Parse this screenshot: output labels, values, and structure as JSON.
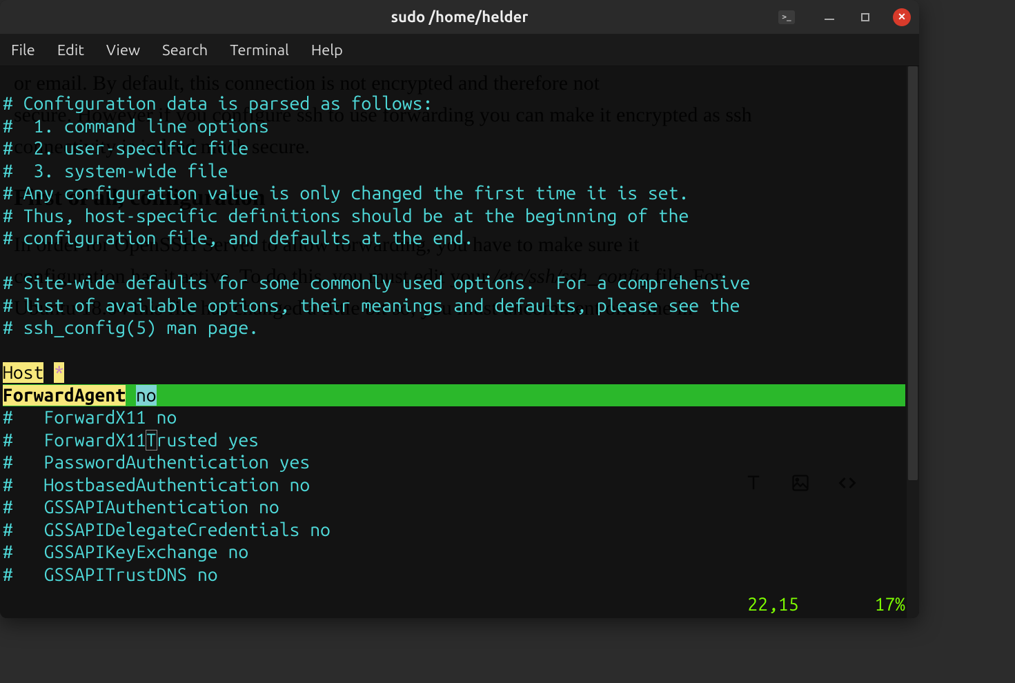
{
  "window": {
    "title": "sudo  /home/helder"
  },
  "menu": [
    "File",
    "Edit",
    "View",
    "Search",
    "Terminal",
    "Help"
  ],
  "background_doc": {
    "line1_a": "     or email. By default, this connection is not encrypted and therefore not",
    "line2_a": "secure. However if you configure ssh to use forwarding you can make it encrypted as ssh",
    "line3_a": "connectivity is indeed much secure.",
    "heading": "First of all, configuration",
    "para2_a": "In order for OpenSSH Server to allow forwarding, you have to make sure it",
    "para2_b": "configuration has it active. To do this, you must edit your ",
    "para2_b_it": "/etc/ssh/ssh_config",
    "para2_b_end": " file. For",
    "para2_c": "Ubuntu 18.04 this file has changed a little bit so, you must uncomment one line in"
  },
  "editor": {
    "comments": [
      "# Configuration data is parsed as follows:",
      "#  1. command line options",
      "#  2. user-specific file",
      "#  3. system-wide file",
      "# Any configuration value is only changed the first time it is set.",
      "# Thus, host-specific definitions should be at the beginning of the",
      "# configuration file, and defaults at the end.",
      "",
      "# Site-wide defaults for some commonly used options.  For a comprehensive",
      "# list of available options, their meanings and defaults, please see the",
      "# ssh_config(5) man page."
    ],
    "host_keyword": "Host",
    "host_glob": "*",
    "current": {
      "key": "ForwardAgent",
      "value": "no"
    },
    "options": [
      "#   ForwardX11 no",
      "#   ForwardX11Trusted yes",
      "#   PasswordAuthentication yes",
      "#   HostbasedAuthentication no",
      "#   GSSAPIAuthentication no",
      "#   GSSAPIDelegateCredentials no",
      "#   GSSAPIKeyExchange no",
      "#   GSSAPITrustDNS no"
    ]
  },
  "status": {
    "pos": "22,15",
    "percent": "17%"
  }
}
